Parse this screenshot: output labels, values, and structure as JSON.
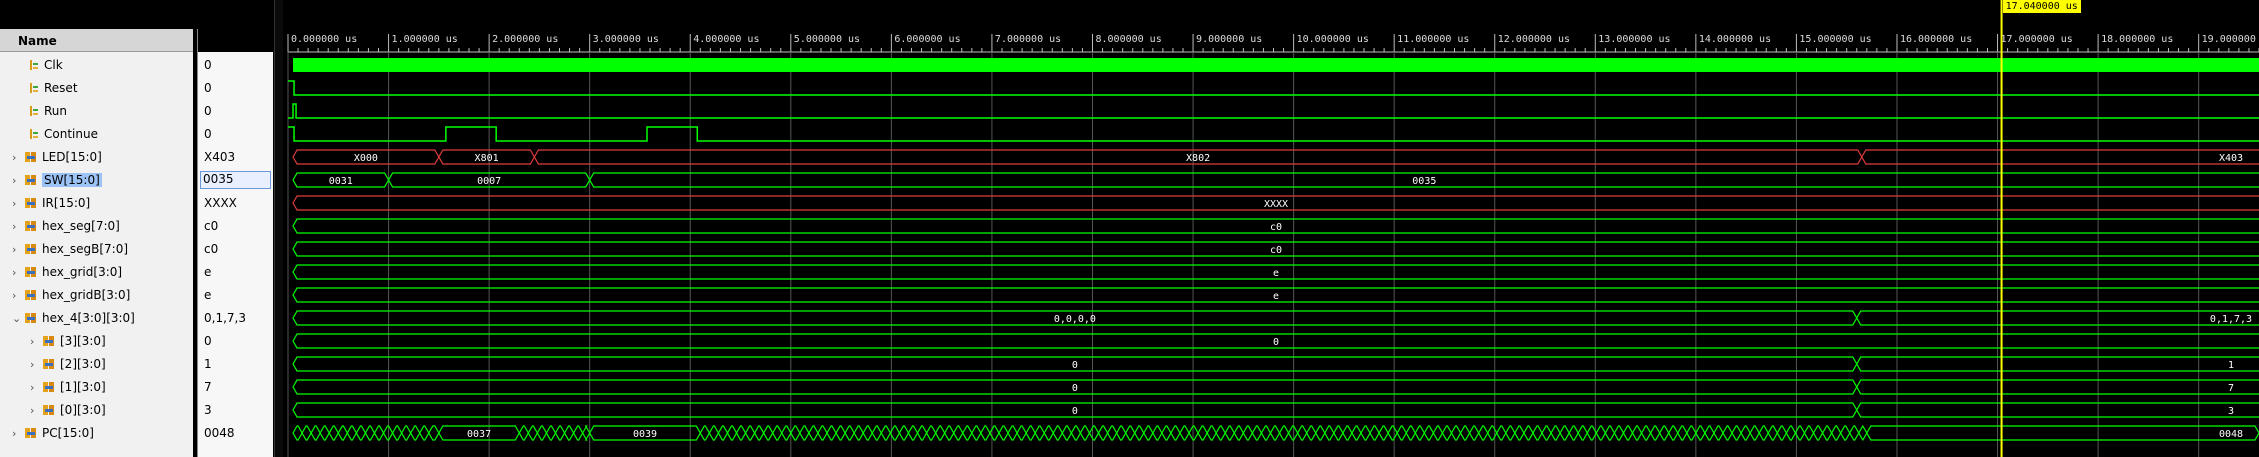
{
  "columns": {
    "name": "Name",
    "value": "Value"
  },
  "signals": [
    {
      "name": "Clk",
      "value": "0",
      "type": "bit",
      "expandable": false,
      "depth": 0
    },
    {
      "name": "Reset",
      "value": "0",
      "type": "bit",
      "expandable": false,
      "depth": 0
    },
    {
      "name": "Run",
      "value": "0",
      "type": "bit",
      "expandable": false,
      "depth": 0
    },
    {
      "name": "Continue",
      "value": "0",
      "type": "bit",
      "expandable": false,
      "depth": 0
    },
    {
      "name": "LED[15:0]",
      "value": "X403",
      "type": "bus",
      "expandable": true,
      "expanded": false,
      "depth": 0
    },
    {
      "name": "SW[15:0]",
      "value": "0035",
      "type": "bus",
      "expandable": true,
      "expanded": false,
      "depth": 0,
      "selected": true
    },
    {
      "name": "IR[15:0]",
      "value": "XXXX",
      "type": "bus",
      "expandable": true,
      "expanded": false,
      "depth": 0
    },
    {
      "name": "hex_seg[7:0]",
      "value": "c0",
      "type": "bus",
      "expandable": true,
      "expanded": false,
      "depth": 0
    },
    {
      "name": "hex_segB[7:0]",
      "value": "c0",
      "type": "bus",
      "expandable": true,
      "expanded": false,
      "depth": 0
    },
    {
      "name": "hex_grid[3:0]",
      "value": "e",
      "type": "bus",
      "expandable": true,
      "expanded": false,
      "depth": 0
    },
    {
      "name": "hex_gridB[3:0]",
      "value": "e",
      "type": "bus",
      "expandable": true,
      "expanded": false,
      "depth": 0
    },
    {
      "name": "hex_4[3:0][3:0]",
      "value": "0,1,7,3",
      "type": "bus",
      "expandable": true,
      "expanded": true,
      "depth": 0
    },
    {
      "name": "[3][3:0]",
      "value": "0",
      "type": "bus",
      "expandable": true,
      "expanded": false,
      "depth": 1
    },
    {
      "name": "[2][3:0]",
      "value": "1",
      "type": "bus",
      "expandable": true,
      "expanded": false,
      "depth": 1
    },
    {
      "name": "[1][3:0]",
      "value": "7",
      "type": "bus",
      "expandable": true,
      "expanded": false,
      "depth": 1
    },
    {
      "name": "[0][3:0]",
      "value": "3",
      "type": "bus",
      "expandable": true,
      "expanded": false,
      "depth": 1
    },
    {
      "name": "PC[15:0]",
      "value": "0048",
      "type": "bus",
      "expandable": true,
      "expanded": false,
      "depth": 0
    }
  ],
  "timeline": {
    "unit": "us",
    "start": 0,
    "end": 19.6,
    "tick_labels": [
      "0.000000 us",
      "1.000000 us",
      "2.000000 us",
      "3.000000 us",
      "4.000000 us",
      "5.000000 us",
      "6.000000 us",
      "7.000000 us",
      "8.000000 us",
      "9.000000 us",
      "10.000000 us",
      "11.000000 us",
      "12.000000 us",
      "13.000000 us",
      "14.000000 us",
      "15.000000 us",
      "16.000000 us",
      "17.000000 us",
      "18.000000 us",
      "19.000000 us"
    ],
    "cursor": {
      "time": 17.04,
      "label": "17.040000 us"
    }
  },
  "waves": [
    {
      "kind": "clock"
    },
    {
      "kind": "bit",
      "initial": 1,
      "transitions": [
        [
          0.06,
          0
        ]
      ]
    },
    {
      "kind": "bit",
      "initial": 0,
      "transitions": [
        [
          0.05,
          1
        ],
        [
          0.08,
          0
        ]
      ]
    },
    {
      "kind": "bit",
      "initial": 1,
      "transitions": [
        [
          0.06,
          0
        ],
        [
          1.57,
          1
        ],
        [
          2.07,
          0
        ],
        [
          3.57,
          1
        ],
        [
          4.07,
          0
        ]
      ]
    },
    {
      "kind": "bus",
      "color": "#e03c3c",
      "segments": [
        [
          0.05,
          1.5,
          "X000"
        ],
        [
          1.5,
          2.45,
          "X801"
        ],
        [
          2.45,
          15.65,
          "X802"
        ],
        [
          15.65,
          19.6,
          "X403"
        ]
      ],
      "label_at_end": true
    },
    {
      "kind": "bus",
      "color": "#00ff00",
      "segments": [
        [
          0.05,
          1.0,
          "0031"
        ],
        [
          1.0,
          3.0,
          "0007"
        ],
        [
          3.0,
          19.6,
          "0035"
        ]
      ]
    },
    {
      "kind": "bus",
      "color": "#e03c3c",
      "segments": [
        [
          0.05,
          19.6,
          "XXXX"
        ]
      ]
    },
    {
      "kind": "bus",
      "color": "#00ff00",
      "segments": [
        [
          0.05,
          19.6,
          "c0"
        ]
      ]
    },
    {
      "kind": "bus",
      "color": "#00ff00",
      "segments": [
        [
          0.05,
          19.6,
          "c0"
        ]
      ]
    },
    {
      "kind": "bus",
      "color": "#00ff00",
      "segments": [
        [
          0.05,
          19.6,
          "e"
        ]
      ]
    },
    {
      "kind": "bus",
      "color": "#00ff00",
      "segments": [
        [
          0.05,
          19.6,
          "e"
        ]
      ]
    },
    {
      "kind": "bus",
      "color": "#00ff00",
      "segments": [
        [
          0.05,
          15.6,
          "0,0,0,0"
        ],
        [
          15.6,
          19.6,
          "0,1,7,3"
        ]
      ],
      "label_at_end": true
    },
    {
      "kind": "bus",
      "color": "#00ff00",
      "segments": [
        [
          0.05,
          19.6,
          "0"
        ]
      ]
    },
    {
      "kind": "bus",
      "color": "#00ff00",
      "segments": [
        [
          0.05,
          15.6,
          "0"
        ],
        [
          15.6,
          19.6,
          "1"
        ]
      ],
      "label_at_end": true
    },
    {
      "kind": "bus",
      "color": "#00ff00",
      "segments": [
        [
          0.05,
          15.6,
          "0"
        ],
        [
          15.6,
          19.6,
          "7"
        ]
      ],
      "label_at_end": true
    },
    {
      "kind": "bus",
      "color": "#00ff00",
      "segments": [
        [
          0.05,
          15.6,
          "0"
        ],
        [
          15.6,
          19.6,
          "3"
        ]
      ],
      "label_at_end": true
    },
    {
      "kind": "bus",
      "color": "#00ff00",
      "dense": true,
      "segments": [
        [
          1.5,
          2.3,
          "0037"
        ],
        [
          3.0,
          4.1,
          "0039"
        ],
        [
          15.7,
          19.6,
          "0048"
        ]
      ],
      "label_at_end": true
    }
  ],
  "colors": {
    "signal": "#00ff00",
    "undefined": "#e03c3c",
    "cursor": "#ffff00",
    "grid": "#555555",
    "background": "#000000"
  },
  "icons": {
    "bit": "bit-signal-icon",
    "bus": "bus-signal-icon",
    "expand": "chevron-right-icon",
    "collapse": "chevron-down-icon"
  }
}
